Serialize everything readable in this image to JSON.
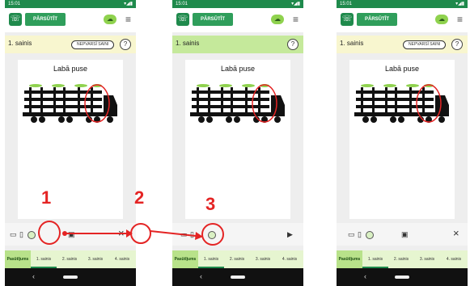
{
  "status": {
    "time": "15:01",
    "icons": "▾◢▮"
  },
  "header": {
    "forward_label": "PĀRSŪTĪT",
    "menu_icon": "≡"
  },
  "trailer": {
    "title": "1. sainis",
    "hide_label": "NEPVARSĪ SAINI",
    "help": "?"
  },
  "drawing": {
    "side_label": "Labā puse"
  },
  "toolbar": {
    "play": "▶",
    "close": "×"
  },
  "tabs": [
    "Pasūtījums",
    "1. sainis",
    "2. sainis",
    "3. sainis",
    "4. sainis"
  ],
  "annotations": {
    "one": "1",
    "two": "2",
    "three": "3"
  },
  "colors": {
    "brand_green": "#1f8a4c",
    "annotation_red": "#e42424"
  }
}
